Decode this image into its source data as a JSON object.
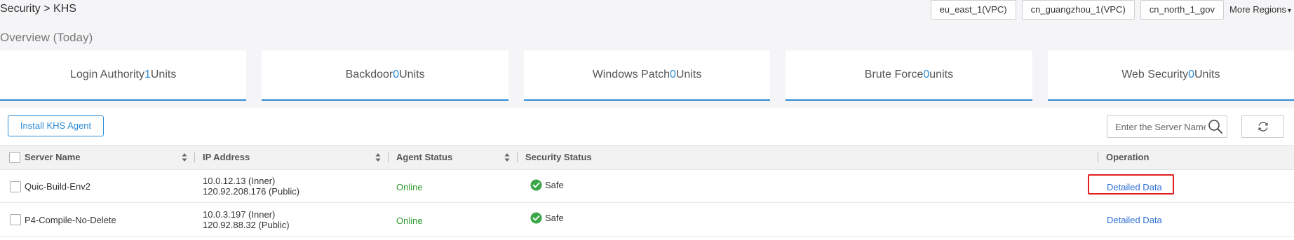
{
  "breadcrumb": "Security > KHS",
  "regions": [
    {
      "label": "eu_east_1(VPC)"
    },
    {
      "label": "cn_guangzhou_1(VPC)"
    },
    {
      "label": "cn_north_1_gov"
    }
  ],
  "more_regions": "More Regions",
  "overview_title": "Overview (Today)",
  "cards": [
    {
      "label": "Login Authority ",
      "count": "1",
      "unit": " Units"
    },
    {
      "label": "Backdoor ",
      "count": "0",
      "unit": " Units"
    },
    {
      "label": "Windows Patch ",
      "count": "0",
      "unit": " Units"
    },
    {
      "label": "Brute Force",
      "count": "0",
      "unit": " units"
    },
    {
      "label": "Web Security ",
      "count": "0",
      "unit": " Units"
    }
  ],
  "toolbar": {
    "install_label": "Install KHS Agent",
    "search_placeholder": "Enter the Server Name"
  },
  "table": {
    "columns": [
      "Server Name",
      "IP Address",
      "Agent Status",
      "Security Status",
      "Operation"
    ],
    "rows": [
      {
        "server_name": "Quic-Build-Env2",
        "ip_inner": "10.0.12.13 (Inner)",
        "ip_public": "120.92.208.176 (Public)",
        "agent_status": "Online",
        "security_status": "Safe",
        "operation": "Detailed Data"
      },
      {
        "server_name": "P4-Compile-No-Delete",
        "ip_inner": "10.0.3.197 (Inner)",
        "ip_public": "120.92.88.32 (Public)",
        "agent_status": "Online",
        "security_status": "Safe",
        "operation": "Detailed Data"
      }
    ]
  },
  "colors": {
    "accent": "#2d8cd6",
    "online": "#2b9a2b",
    "safe": "#3aa648",
    "highlight": "#e02020"
  }
}
